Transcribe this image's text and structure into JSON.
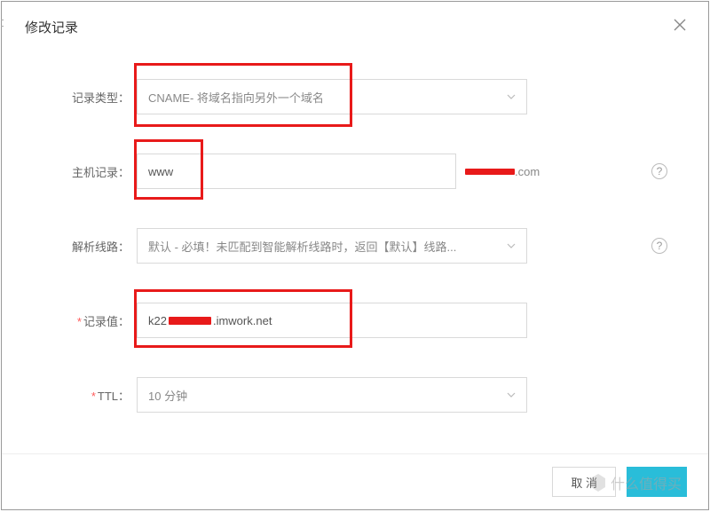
{
  "header": {
    "title": "修改记录"
  },
  "fields": {
    "recordType": {
      "label": "记录类型：",
      "value": "CNAME- 将域名指向另外一个域名"
    },
    "hostRecord": {
      "label": "主机记录：",
      "value": "www",
      "suffix": ".com"
    },
    "line": {
      "label": "解析线路：",
      "value": "默认 - 必填！未匹配到智能解析线路时，返回【默认】线路..."
    },
    "recordValue": {
      "label": "记录值：",
      "value": "k22",
      "valueSuffix": ".imwork.net"
    },
    "ttl": {
      "label": "TTL：",
      "value": "10 分钟"
    }
  },
  "buttons": {
    "cancel": "取 消",
    "confirm": ""
  },
  "watermark": "什么值得买",
  "help": "?"
}
